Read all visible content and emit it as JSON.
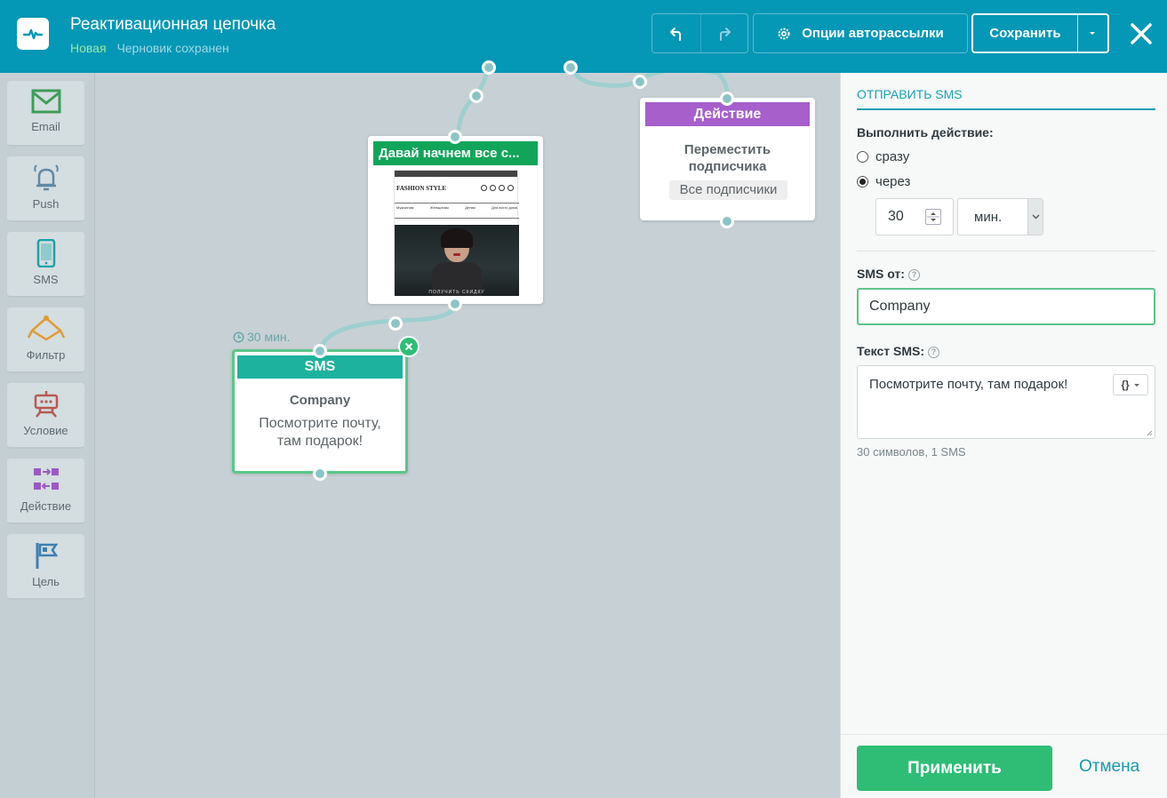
{
  "header": {
    "title": "Реактивационная цепочка",
    "status_new": "Новая",
    "status_draft": "Черновик сохранен",
    "options_label": "Опции авторассылки",
    "save_label": "Сохранить"
  },
  "toolbox": {
    "items": [
      {
        "label": "Email",
        "icon": "envelope-icon",
        "color": "#3f9c5b"
      },
      {
        "label": "Push",
        "icon": "bell-icon",
        "color": "#5f8aa8"
      },
      {
        "label": "SMS",
        "icon": "phone-icon",
        "color": "#15a3a8"
      },
      {
        "label": "Фильтр",
        "icon": "filter-icon",
        "color": "#e19b32"
      },
      {
        "label": "Условие",
        "icon": "condition-icon",
        "color": "#b55a52"
      },
      {
        "label": "Действие",
        "icon": "action-icon",
        "color": "#9b59c5"
      },
      {
        "label": "Цель",
        "icon": "flag-icon",
        "color": "#3f7fb0"
      }
    ]
  },
  "canvas": {
    "email_node": {
      "header": "Давай начнем все с...",
      "header_color": "#11a55a",
      "preview": {
        "brand": "FASHION STYLE",
        "menu": [
          "Мужчинам",
          "Женщинам",
          "Детям",
          "Для всего дома"
        ],
        "cta": "ПОЛУЧИТЬ СКИДКУ"
      }
    },
    "action_node": {
      "header": "Действие",
      "header_color": "#a65fcb",
      "title": "Переместить подписчика",
      "tag": "Все подписчики"
    },
    "sms_node": {
      "delay": "30 мин.",
      "header": "SMS",
      "header_color": "#1db29d",
      "sender": "Company",
      "text": "Посмотрите почту, там подарок!"
    }
  },
  "panel": {
    "title": "ОТПРАВИТЬ SMS",
    "perform_label": "Выполнить действие:",
    "option_now": "сразу",
    "option_after": "через",
    "selected_option": "через",
    "delay_value": "30",
    "delay_unit": "мин.",
    "sms_from_label": "SMS от:",
    "sms_from_value": "Company",
    "sms_text_label": "Текст SMS:",
    "sms_text_value": "Посмотрите почту, там подарок!",
    "var_button": "{}",
    "counter": "30 символов, 1 SMS",
    "apply_label": "Применить",
    "cancel_label": "Отмена"
  },
  "colors": {
    "header_bg": "#0597b6",
    "canvas_bg": "#c7d1d5",
    "apply_bg": "#2fbd76",
    "accent": "#1aa0b4"
  }
}
